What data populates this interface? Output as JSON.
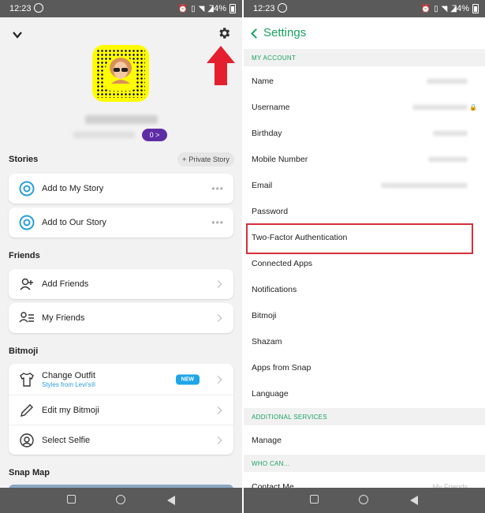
{
  "status_bar": {
    "time": "12:23",
    "battery": "74%"
  },
  "left": {
    "score_badge": "0 >",
    "stories": {
      "title": "Stories",
      "private_story": "Private Story",
      "items": [
        "Add to My Story",
        "Add to Our Story"
      ]
    },
    "friends": {
      "title": "Friends",
      "items": [
        "Add Friends",
        "My Friends"
      ]
    },
    "bitmoji": {
      "title": "Bitmoji",
      "change_outfit": "Change Outfit",
      "change_outfit_sub": "Styles from Levi's®",
      "new_badge": "NEW",
      "edit": "Edit my Bitmoji",
      "selfie": "Select Selfie"
    },
    "snap_map": {
      "title": "Snap Map"
    }
  },
  "right": {
    "title": "Settings",
    "sections": {
      "my_account": "MY ACCOUNT",
      "additional": "ADDITIONAL SERVICES",
      "who_can": "WHO CAN..."
    },
    "items": {
      "name": "Name",
      "username": "Username",
      "birthday": "Birthday",
      "mobile": "Mobile Number",
      "email": "Email",
      "password": "Password",
      "two_factor": "Two-Factor Authentication",
      "connected_apps": "Connected Apps",
      "notifications": "Notifications",
      "bitmoji": "Bitmoji",
      "shazam": "Shazam",
      "apps_from_snap": "Apps from Snap",
      "language": "Language",
      "manage": "Manage",
      "contact_me": "Contact Me",
      "contact_me_value": "My Friends"
    }
  },
  "colors": {
    "accent_green": "#1aa260",
    "highlight_red": "#d32f3a",
    "snap_yellow": "#fffc00",
    "new_blue": "#1fa5e8"
  }
}
